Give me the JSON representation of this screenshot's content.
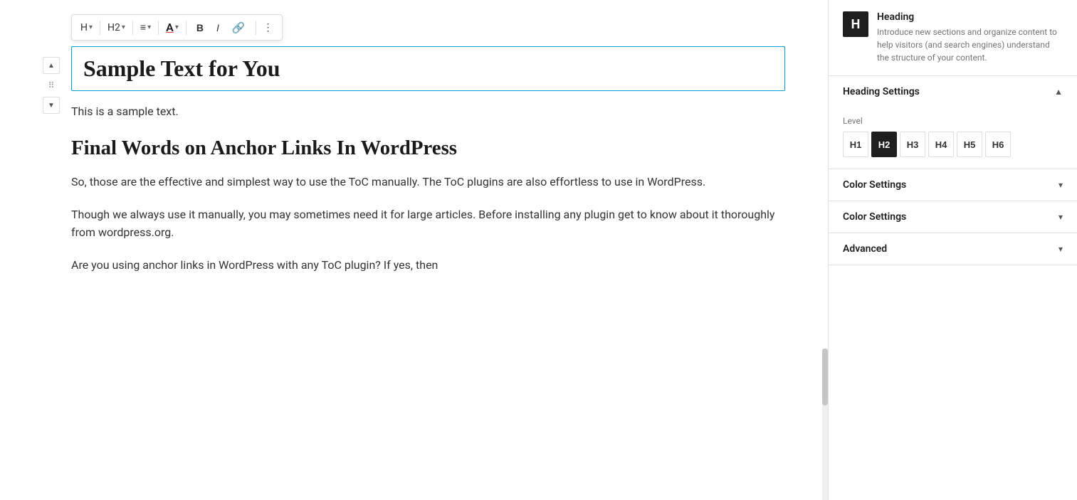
{
  "toolbar": {
    "heading_level_dropdown": "H",
    "heading_size_dropdown": "H2",
    "align_dropdown": "≡",
    "color_label": "A",
    "bold_label": "B",
    "italic_label": "I",
    "link_label": "🔗",
    "more_label": "⋮",
    "dropdown_arrow": "▾"
  },
  "heading_block": {
    "text": "Sample Text for You"
  },
  "content": {
    "paragraph1": "This is a sample text.",
    "heading2": "Final Words on Anchor Links In WordPress",
    "paragraph2": "So, those are the effective and simplest way to use the ToC manually. The ToC plugins are also effortless to use in WordPress.",
    "paragraph3": "Though we always use it manually, you may sometimes need it for large articles. Before installing any plugin get to know about it thoroughly from wordpress.org.",
    "paragraph4": "Are you using anchor links in WordPress with any ToC plugin? If yes, then"
  },
  "sidebar": {
    "block_icon_letter": "H",
    "block_title": "Heading",
    "block_description": "Introduce new sections and organize content to help visitors (and search engines) understand the structure of your content.",
    "sections": [
      {
        "id": "heading-settings",
        "title": "Heading Settings",
        "expanded": true,
        "chevron": "▲"
      },
      {
        "id": "color-settings-1",
        "title": "Color Settings",
        "expanded": false,
        "chevron": "▾"
      },
      {
        "id": "color-settings-2",
        "title": "Color Settings",
        "expanded": false,
        "chevron": "▾"
      },
      {
        "id": "advanced",
        "title": "Advanced",
        "expanded": false,
        "chevron": "▾"
      }
    ],
    "level_label": "Level",
    "levels": [
      "H1",
      "H2",
      "H3",
      "H4",
      "H5",
      "H6"
    ],
    "active_level": "H2"
  }
}
